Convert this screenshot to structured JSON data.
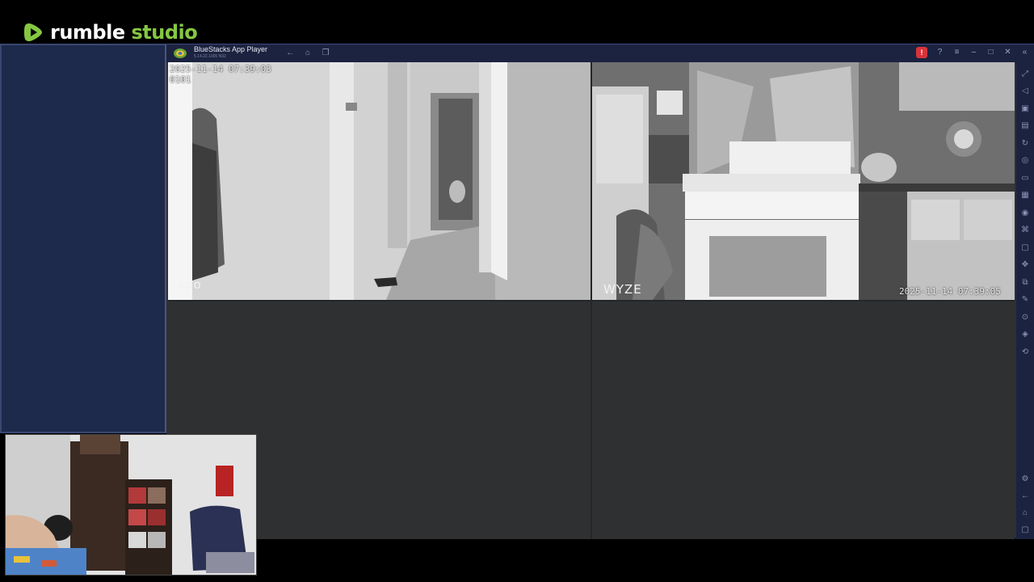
{
  "brand": {
    "name_main": "rumble",
    "name_accent": "studio",
    "accent_color": "#85c742"
  },
  "window": {
    "title": "BlueStacks App Player",
    "version": "5.14.22.1005 N32",
    "record_badge": "!"
  },
  "nav_icons": [
    "back-icon",
    "home-icon",
    "multi-instance-icon"
  ],
  "titlebar_controls": [
    "record-icon",
    "help-icon",
    "menu-icon",
    "minimize-icon",
    "maximize-icon",
    "close-icon",
    "collapse-sidebar-icon"
  ],
  "sidebar_tools": [
    "fullscreen-icon",
    "volume-icon",
    "media-icon",
    "screenshot-icon",
    "rotate-icon",
    "sync-icon",
    "gamepad-icon",
    "apk-icon",
    "screen-record-icon",
    "macro-icon",
    "folder-icon",
    "shake-icon",
    "copy-icon",
    "eco-mode-icon",
    "location-icon",
    "layers-icon",
    "restore-icon"
  ],
  "sidebar_bottom_tools": [
    "settings-icon",
    "back-arrow-icon",
    "home-icon",
    "recent-apps-icon"
  ],
  "cameras": [
    {
      "brand": "tapo",
      "timestamp": "2025-11-14 07:39:03",
      "channel": "0101"
    },
    {
      "brand": "WYZE",
      "timestamp": "2025-11-14 07:39:05"
    },
    {},
    {}
  ]
}
